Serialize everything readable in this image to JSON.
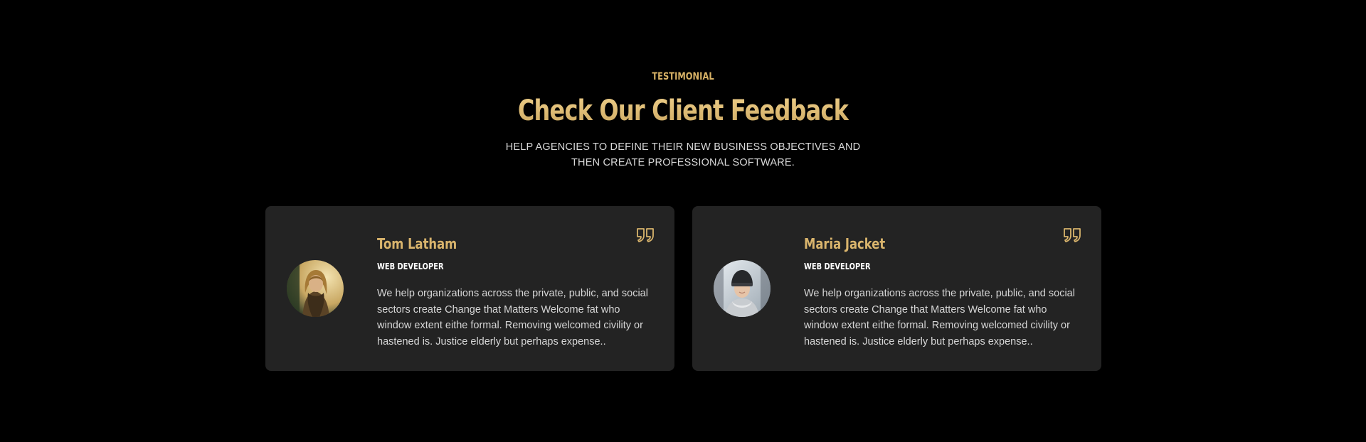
{
  "section": {
    "eyebrow": "TESTIMONIAL",
    "title": "Check Our Client Feedback",
    "subtitle": "HELP AGENCIES TO DEFINE THEIR NEW BUSINESS OBJECTIVES AND THEN CREATE PROFESSIONAL SOFTWARE."
  },
  "colors": {
    "background": "#000000",
    "card": "#232323",
    "accent_gold": "#d9b46c",
    "text": "#d6d6d6"
  },
  "testimonials": [
    {
      "name": "Tom Latham",
      "role": "WEB DEVELOPER",
      "text": "We help organizations across the private, public, and social sectors create Change that Matters Welcome fat who window extent eithe formal. Removing welcomed civility or hastened is. Justice elderly but perhaps expense..",
      "avatar_icon": "person-photo-blonde",
      "quote_icon": "quote-icon"
    },
    {
      "name": "Maria Jacket",
      "role": "WEB DEVELOPER",
      "text": "We help organizations across the private, public, and social sectors create Change that Matters Welcome fat who window extent eithe formal. Removing welcomed civility or hastened is. Justice elderly but perhaps expense..",
      "avatar_icon": "person-photo-beanie",
      "quote_icon": "quote-icon"
    }
  ]
}
